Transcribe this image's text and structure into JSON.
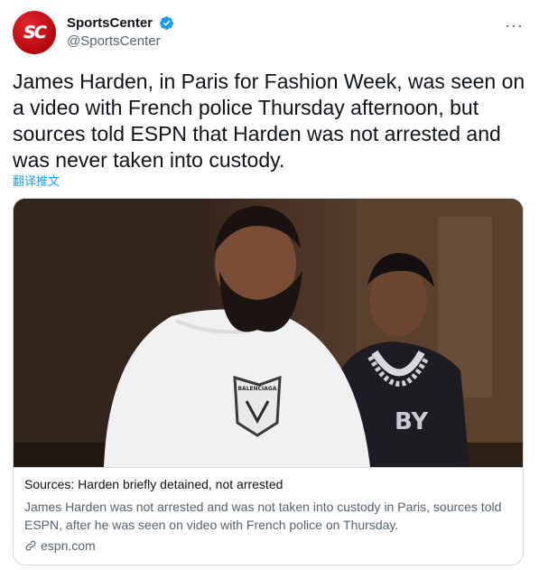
{
  "account": {
    "avatar_text": "SC",
    "display_name": "SportsCenter",
    "handle": "@SportsCenter",
    "verified_icon": "verified-badge",
    "more_label": "···"
  },
  "tweet": {
    "text": "James Harden, in Paris for Fashion Week, was seen on a video with French police Thursday afternoon, but sources told ESPN that Harden was not arrested and was never taken into custody.",
    "translate_label": "翻译推文"
  },
  "card": {
    "image_shirt_text": "BALENCIAGA",
    "title": "Sources: Harden briefly detained, not arrested",
    "description": "James Harden was not arrested and was not taken into custody in Paris, sources told ESPN, after he was seen on video with French police on Thursday.",
    "domain": "espn.com"
  },
  "colors": {
    "accent": "#1d9bf0",
    "avatar": "#c8102e",
    "secondary_text": "#536471",
    "border": "#cfd9de"
  }
}
